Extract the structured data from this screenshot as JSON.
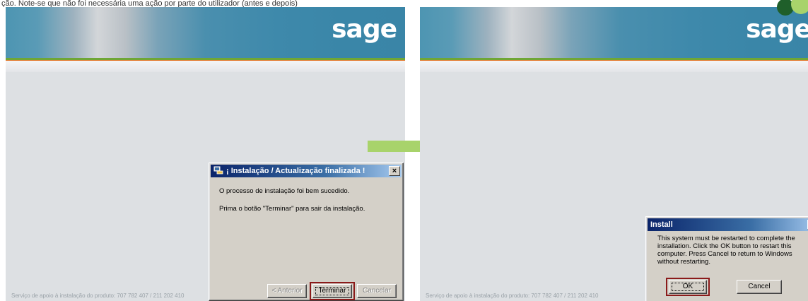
{
  "caption": "ção. Note-se que não foi necessária uma ação por parte do utilizador (antes e depois)",
  "left_screen": {
    "logo": "sage",
    "footer": "Serviço de apoio à instalação do produto: 707 782 407 / 211 202 410",
    "dialog": {
      "title": "¡ Instalação / Actualização finalizada !",
      "message1": "O processo de instalação foi bem sucedido.",
      "message2": "Prima o botão \"Terminar\" para sair da instalação.",
      "back_label": "< Anterior",
      "finish_label": "Terminar",
      "cancel_label": "Cancelar",
      "close_glyph": "×"
    }
  },
  "right_screen": {
    "logo": "sage",
    "footer": "Serviço de apoio à instalação do produto: 707 782 407 / 211 202 410",
    "dialog": {
      "title": "Install",
      "message": "This system must be restarted to complete the installation. Click the OK button to restart this computer. Press Cancel to return to Windows without restarting.",
      "ok_label": "OK",
      "cancel_label": "Cancel",
      "close_glyph": "×"
    }
  },
  "colors": {
    "highlight_border": "#8b1a1a",
    "arrow": "#a8d36b",
    "titlebar": "#0a246a"
  }
}
